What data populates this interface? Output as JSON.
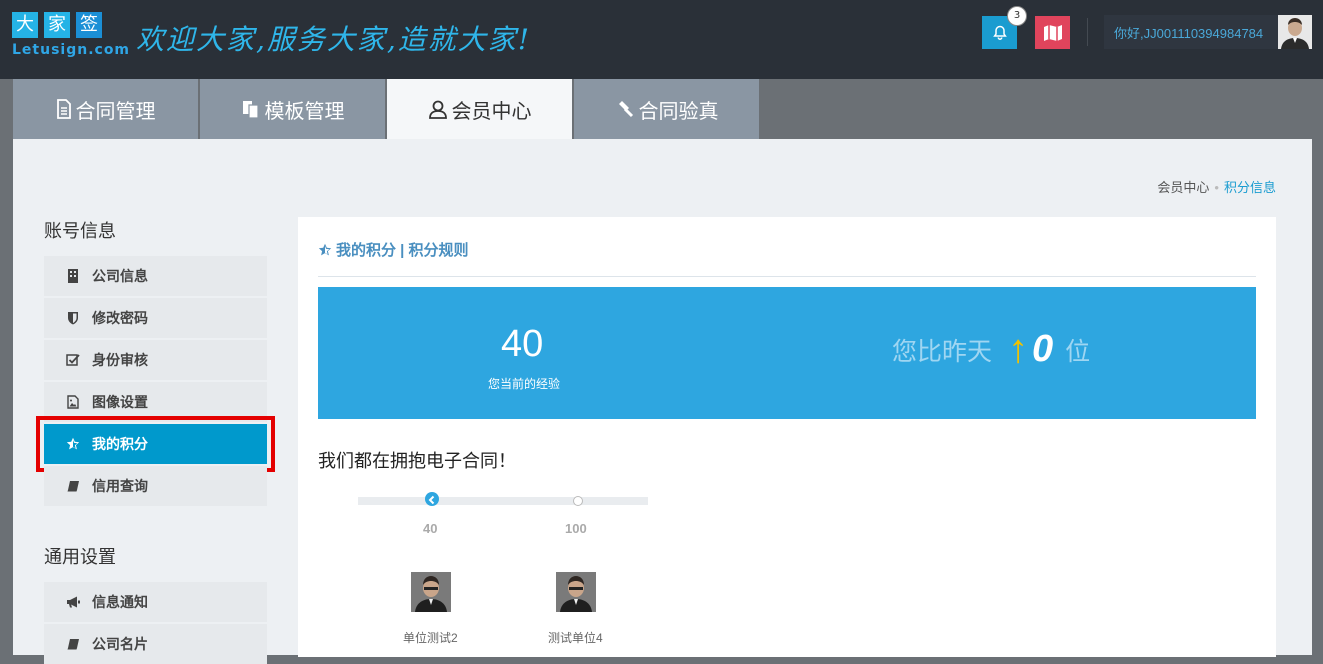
{
  "logo": {
    "chars": [
      "大",
      "家",
      "签"
    ],
    "domain": "Letusign.com"
  },
  "slogan": "欢迎大家,服务大家,造就大家!",
  "header": {
    "notification_count": "3",
    "greeting": "你好,JJ001110394984784"
  },
  "tabs": [
    {
      "label": "合同管理",
      "icon": "document-icon"
    },
    {
      "label": "模板管理",
      "icon": "copy-icon"
    },
    {
      "label": "会员中心",
      "icon": "user-icon"
    },
    {
      "label": "合同验真",
      "icon": "gavel-icon"
    }
  ],
  "breadcrumb": {
    "parent": "会员中心",
    "current": "积分信息"
  },
  "sidebar": {
    "account_heading": "账号信息",
    "account_items": [
      {
        "label": "公司信息",
        "icon": "building-icon"
      },
      {
        "label": "修改密码",
        "icon": "shield-icon"
      },
      {
        "label": "身份审核",
        "icon": "check-square-icon"
      },
      {
        "label": "图像设置",
        "icon": "image-icon"
      },
      {
        "label": "我的积分",
        "icon": "star-icon"
      },
      {
        "label": "信用查询",
        "icon": "book-icon"
      }
    ],
    "general_heading": "通用设置",
    "general_items": [
      {
        "label": "信息通知",
        "icon": "bullhorn-icon"
      },
      {
        "label": "公司名片",
        "icon": "book-icon"
      }
    ]
  },
  "main": {
    "title": "我的积分 | 积分规则",
    "score": "40",
    "score_caption": "您当前的经验",
    "rank_prefix": "您比昨天",
    "rank_value": "0",
    "rank_suffix": "位",
    "slogan": "我们都在拥抱电子合同！",
    "levels": [
      "40",
      "100"
    ],
    "people": [
      "单位测试2",
      "测试单位4"
    ]
  },
  "colors": {
    "accent": "#2ea6e0",
    "active_tab": "#0099cc",
    "highlight_border": "#e40000",
    "badge_red": "#e0445c"
  }
}
